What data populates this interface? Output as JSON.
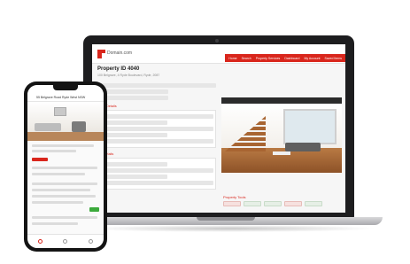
{
  "app": {
    "brand": "Domain.com",
    "nav": [
      "Home",
      "Search",
      "Property Services",
      "Dashboard",
      "My Account",
      "Saved Items"
    ],
    "page_title": "Property ID 4040",
    "page_subtitle": "100 Belgrave, 4 Ryde Boulevard, Ryde, 2087",
    "sections": [
      "Listing Details",
      "Sale Details"
    ],
    "property_tools_title": "Property Tools"
  },
  "phone": {
    "title": "55 Belgrave Road Ryde West NSW"
  },
  "colors": {
    "accent": "#d9261c",
    "success": "#3caa3c"
  }
}
